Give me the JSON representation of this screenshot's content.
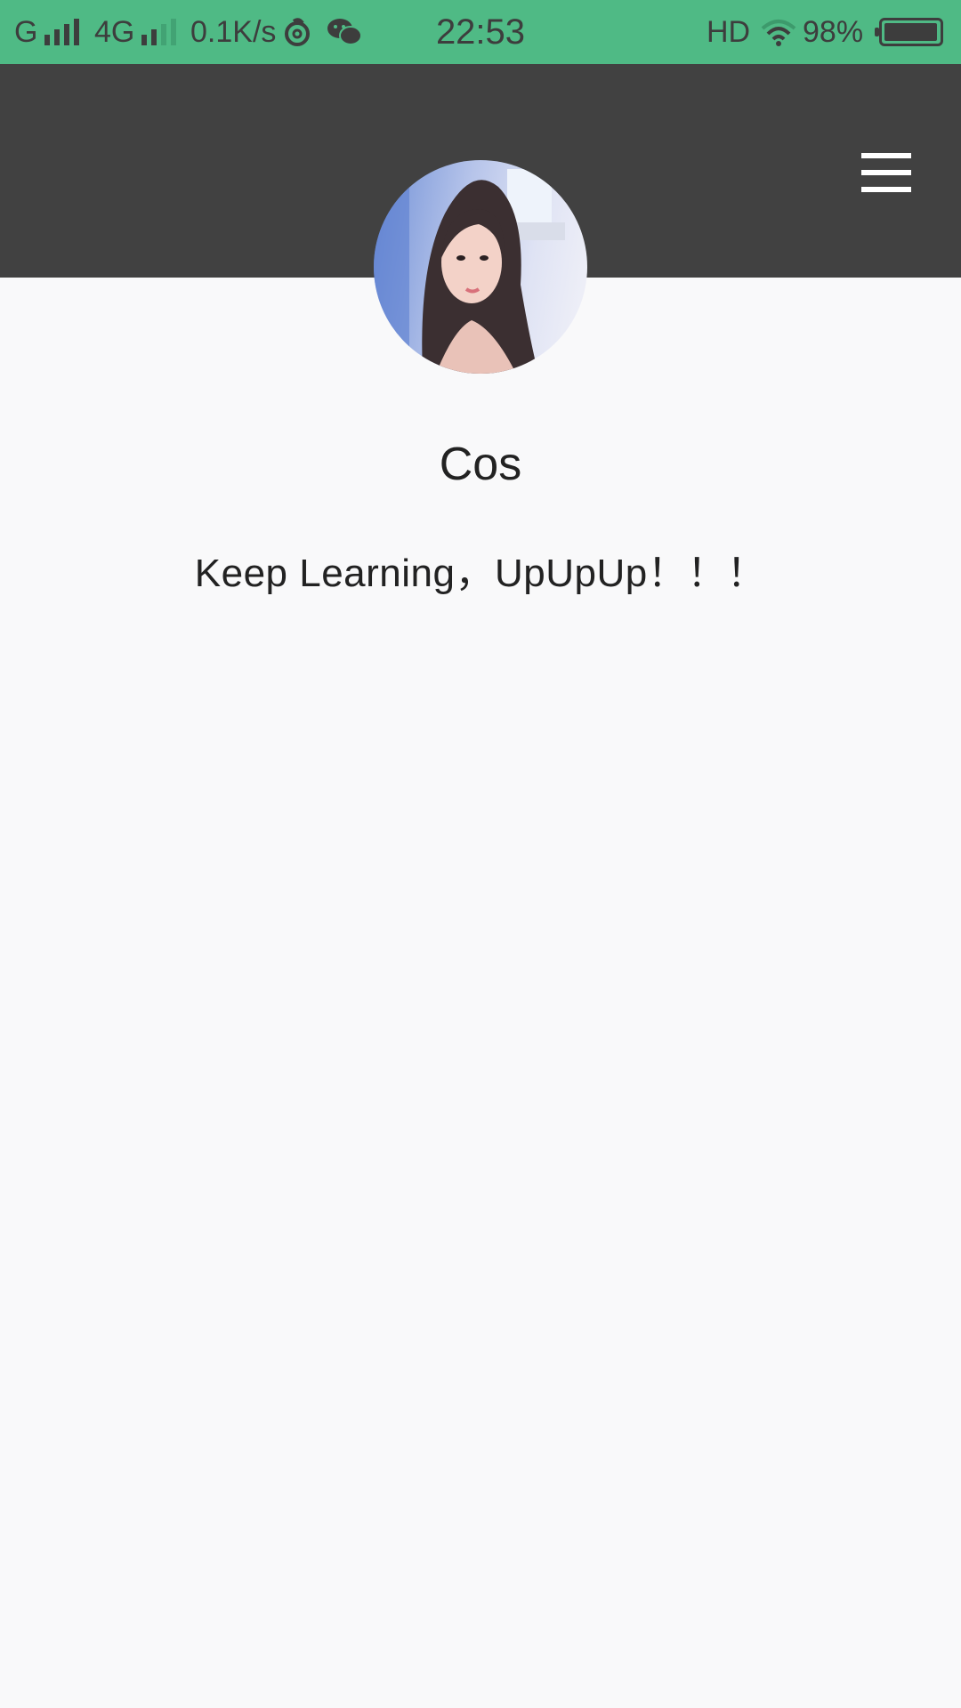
{
  "status_bar": {
    "carrier1": "G",
    "carrier2": "4G",
    "network_speed": "0.1K/s",
    "time": "22:53",
    "hd": "HD",
    "battery_percent_label": "98%",
    "battery_level": 0.98,
    "icons": [
      "signal-icon",
      "signal-icon",
      "netease-music-icon",
      "wechat-icon",
      "wifi-icon",
      "battery-icon"
    ]
  },
  "header": {
    "menu_icon": "hamburger-menu-icon",
    "background_color": "#414141"
  },
  "profile": {
    "name": "Cos",
    "bio": "Keep Learning，UpUpUp！！！"
  },
  "colors": {
    "status_bar": "#4fba85",
    "page_background": "#f9f9fa"
  }
}
